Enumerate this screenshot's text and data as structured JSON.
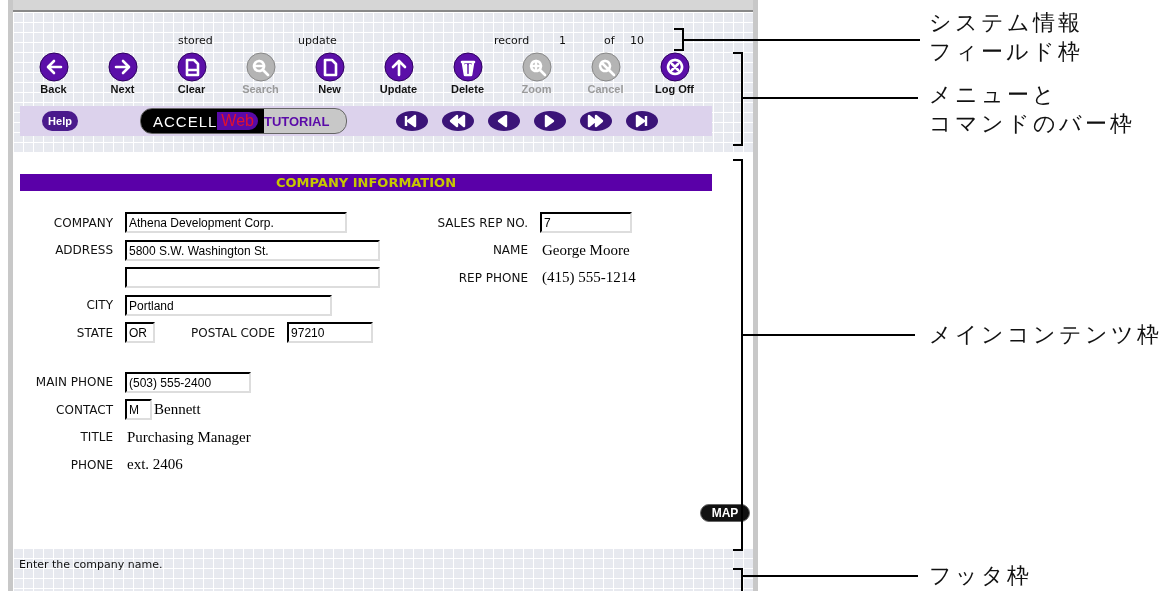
{
  "system_info": {
    "stored": "stored",
    "update": "update",
    "record_label": "record",
    "record_number": "1",
    "of_label": "of",
    "record_total": "10"
  },
  "toolbar": [
    {
      "label": "Back",
      "kind": "back",
      "disabled": false
    },
    {
      "label": "Next",
      "kind": "next",
      "disabled": false
    },
    {
      "label": "Clear",
      "kind": "clear",
      "disabled": false
    },
    {
      "label": "Search",
      "kind": "search",
      "disabled": true
    },
    {
      "label": "New",
      "kind": "new",
      "disabled": false
    },
    {
      "label": "Update",
      "kind": "update",
      "disabled": false
    },
    {
      "label": "Delete",
      "kind": "delete",
      "disabled": false
    },
    {
      "label": "Zoom",
      "kind": "zoom",
      "disabled": true
    },
    {
      "label": "Cancel",
      "kind": "cancel",
      "disabled": true
    },
    {
      "label": "Log Off",
      "kind": "logoff",
      "disabled": false
    }
  ],
  "help_button": "Help",
  "brand": {
    "left": "ACCELL",
    "middle": "Web",
    "right": "TUTORIAL"
  },
  "record_nav": [
    {
      "kind": "first"
    },
    {
      "kind": "rewind"
    },
    {
      "kind": "prev"
    },
    {
      "kind": "next"
    },
    {
      "kind": "forward"
    },
    {
      "kind": "last"
    }
  ],
  "section_title": "COMPANY INFORMATION",
  "address_rows": [
    [
      {
        "label": "COMPANY",
        "kind": "input",
        "value": "Athena Development Corp."
      }
    ],
    [
      {
        "label": "ADDRESS",
        "kind": "input",
        "value": "5800 S.W. Washington St."
      }
    ],
    [
      {
        "kind": "input"
      }
    ],
    [
      {
        "label": "CITY",
        "kind": "input",
        "value": "Portland"
      }
    ],
    [
      {
        "label": "STATE",
        "kind": "input",
        "value": "OR"
      },
      {
        "label": "POSTAL CODE",
        "kind": "input",
        "value": "97210"
      }
    ]
  ],
  "contact_rows": [
    {
      "label": "MAIN PHONE",
      "kind": "input",
      "value": "(503) 555-2400"
    },
    {
      "label": "CONTACT",
      "kind": "input",
      "value": "M",
      "extra": "Bennett"
    },
    {
      "label": "TITLE",
      "kind": "text",
      "value": "Purchasing Manager"
    },
    {
      "label": "PHONE",
      "kind": "text",
      "value": "ext. 2406"
    }
  ],
  "rep_rows": [
    {
      "label": "SALES REP NO.",
      "kind": "input",
      "value": "7"
    },
    {
      "label": "NAME",
      "kind": "text",
      "value": "George Moore"
    },
    {
      "label": "REP PHONE",
      "kind": "text",
      "value": "(415) 555-1214"
    }
  ],
  "map_button": "MAP",
  "footer_message": "Enter the company name.",
  "annotations": [
    {
      "kind": "system",
      "lines": [
        "システム情報",
        "フィールド枠"
      ]
    },
    {
      "kind": "menu",
      "lines": [
        "メニューと",
        "コマンドのバー枠"
      ]
    },
    {
      "kind": "main",
      "lines": [
        "メインコンテンツ枠"
      ]
    },
    {
      "kind": "footer",
      "lines": [
        "フッタ枠"
      ]
    }
  ]
}
